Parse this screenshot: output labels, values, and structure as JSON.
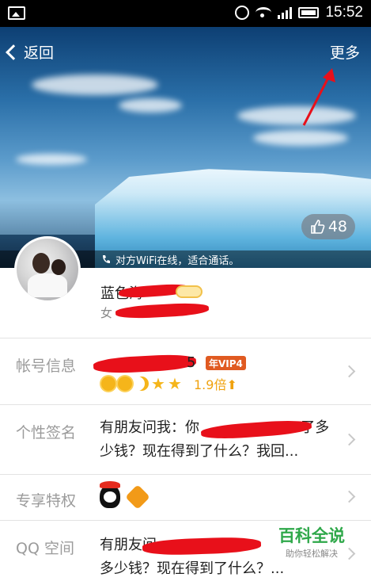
{
  "status_bar": {
    "time": "15:52"
  },
  "header": {
    "back_label": "返回",
    "more_label": "更多",
    "likes": "48",
    "wifi_notice": "对方WiFi在线，适合通话。"
  },
  "profile": {
    "nickname": "蓝色海",
    "gender": "女"
  },
  "account_row": {
    "label": "帐号信息",
    "vip": "年VIP4",
    "speed": "1.9倍"
  },
  "signature_row": {
    "label": "个性签名",
    "line1": "有朋友问我：你",
    "line1_end": "\"了多",
    "line2": "少钱？现在得到了什么？我回..."
  },
  "privilege_row": {
    "label": "专享特权"
  },
  "qzone_row": {
    "label": "QQ 空间",
    "line1": "有朋友问",
    "line2": "多少钱？现在得到了什么？..."
  },
  "watermark": {
    "title": "百科全说",
    "subtitle": "助你轻松解决"
  },
  "colors": {
    "accent": "#e05a21",
    "label_gray": "#9b9b9b",
    "redaction": "#e8101a",
    "level_gold": "#f5b51a"
  }
}
